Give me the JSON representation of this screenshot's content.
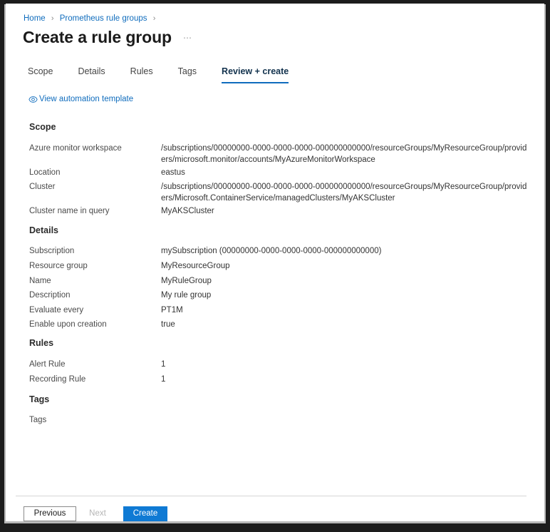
{
  "breadcrumb": {
    "items": [
      {
        "label": "Home"
      },
      {
        "label": "Prometheus rule groups"
      }
    ],
    "separator": "›"
  },
  "header": {
    "title": "Create a rule group",
    "overflow_label": "⋯"
  },
  "tabs": [
    {
      "label": "Scope",
      "active": false
    },
    {
      "label": "Details",
      "active": false
    },
    {
      "label": "Rules",
      "active": false
    },
    {
      "label": "Tags",
      "active": false
    },
    {
      "label": "Review + create",
      "active": true
    }
  ],
  "automation_link": {
    "label": "View automation template",
    "icon": "eye-icon"
  },
  "sections": [
    {
      "heading": "Scope",
      "rows": [
        {
          "label": "Azure monitor workspace",
          "value": "/subscriptions/00000000-0000-0000-0000-000000000000/resourceGroups/MyResourceGroup/providers/microsoft.monitor/accounts/MyAzureMonitorWorkspace"
        },
        {
          "label": "Location",
          "value": "eastus"
        },
        {
          "label": "Cluster",
          "value": "/subscriptions/00000000-0000-0000-0000-000000000000/resourceGroups/MyResourceGroup/providers/Microsoft.ContainerService/managedClusters/MyAKSCluster"
        },
        {
          "label": "Cluster name in query",
          "value": "MyAKSCluster"
        }
      ]
    },
    {
      "heading": "Details",
      "rows": [
        {
          "label": "Subscription",
          "value": "mySubscription (00000000-0000-0000-0000-000000000000)"
        },
        {
          "label": "Resource group",
          "value": "MyResourceGroup"
        },
        {
          "label": "Name",
          "value": "MyRuleGroup"
        },
        {
          "label": "Description",
          "value": "My rule group"
        },
        {
          "label": "Evaluate every",
          "value": "PT1M"
        },
        {
          "label": "Enable upon creation",
          "value": "true"
        }
      ]
    },
    {
      "heading": "Rules",
      "rows": [
        {
          "label": "Alert Rule",
          "value": "1"
        },
        {
          "label": "Recording Rule",
          "value": "1"
        }
      ]
    },
    {
      "heading": "Tags",
      "rows": [
        {
          "label": "Tags",
          "value": ""
        }
      ]
    }
  ],
  "footer": {
    "previous_label": "Previous",
    "next_label": "Next",
    "create_label": "Create"
  },
  "colors": {
    "accent": "#0f6cbd",
    "primary_button": "#0f7ad4",
    "link": "#0f6cbd"
  }
}
